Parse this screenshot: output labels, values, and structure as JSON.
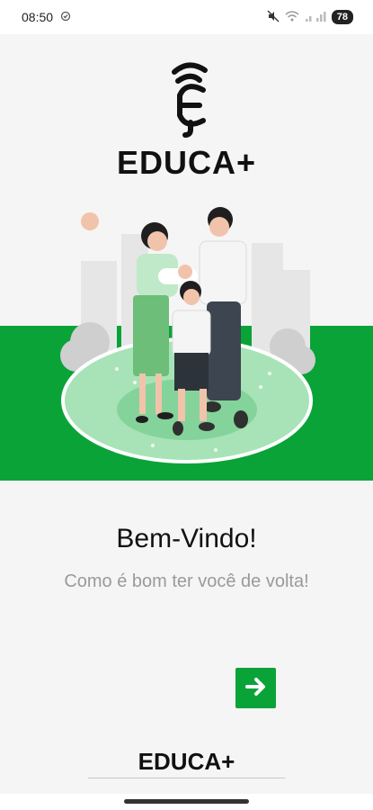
{
  "status": {
    "time": "08:50",
    "battery": "78"
  },
  "brand": {
    "name": "EDUCA+"
  },
  "welcome": {
    "title": "Bem-Vindo!",
    "subtitle": "Como é bom ter você de volta!"
  },
  "colors": {
    "accent": "#0aa338"
  },
  "icons": {
    "next": "arrow-right-icon",
    "logo": "educa-logo"
  }
}
